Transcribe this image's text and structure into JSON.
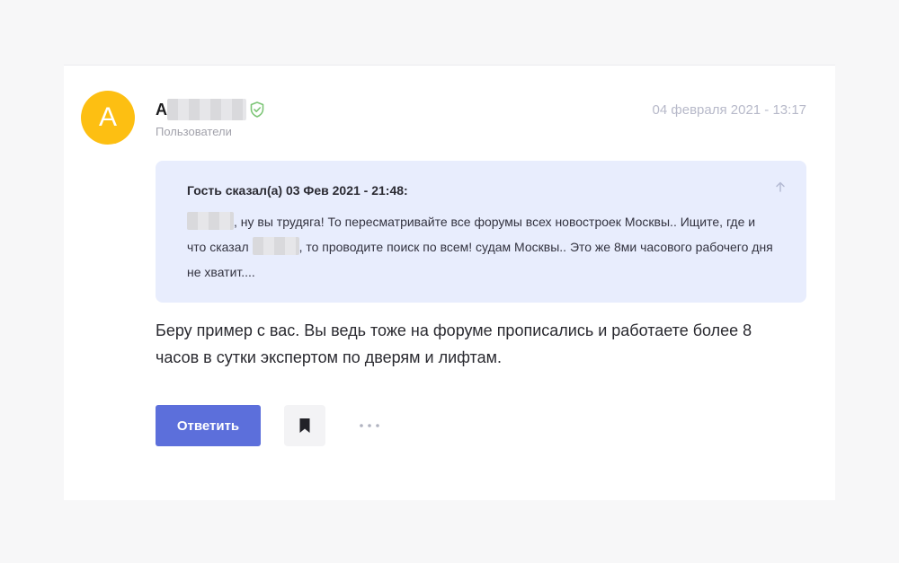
{
  "post": {
    "avatar_letter": "A",
    "author_initial": "A",
    "author_role": "Пользователи",
    "timestamp": "04 февраля 2021 - 13:17",
    "quote": {
      "header": "Гость сказал(а) 03 Фев 2021 - 21:48:",
      "text_part1": ", ну вы трудяга! То пересматривайте все форумы всех новостроек Москвы.. Ищите, где и что сказал ",
      "text_part2": ", то проводите поиск по всем! судам Москвы.. Это же 8ми часового рабочего дня не хватит...."
    },
    "body": "Беру пример с вас. Вы ведь тоже на форуме прописались и работаете более 8 часов в сутки экспертом по дверям и лифтам."
  },
  "actions": {
    "reply_label": "Ответить",
    "bookmark_icon": "bookmark-icon",
    "more_icon": "more-dots-icon"
  },
  "colors": {
    "avatar": "#fdbf12",
    "verified": "#7cc576",
    "quote_bg": "#e8edfd",
    "reply_button": "#5c6fdb"
  }
}
